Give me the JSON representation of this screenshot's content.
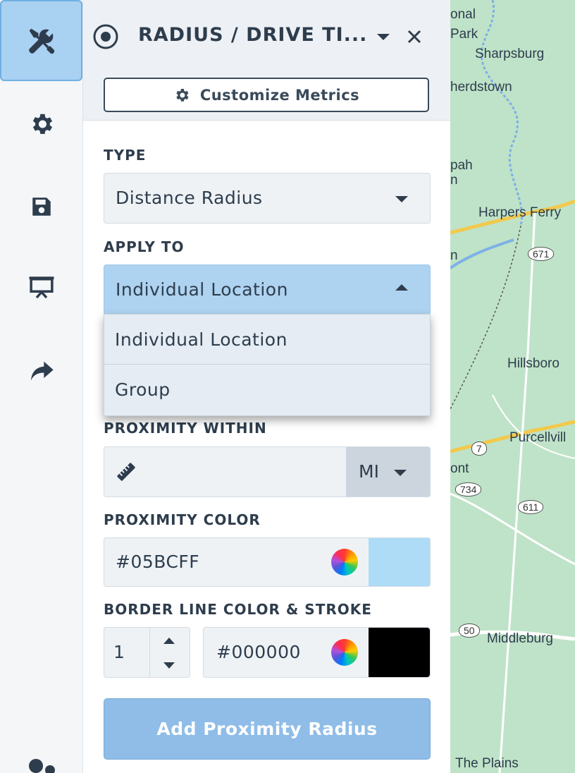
{
  "panel": {
    "title": "RADIUS / DRIVE TI...",
    "customize_label": "Customize Metrics"
  },
  "form": {
    "type_label": "TYPE",
    "type_value": "Distance Radius",
    "apply_label": "APPLY TO",
    "apply_value": "Individual Location",
    "apply_options": [
      "Individual Location",
      "Group"
    ],
    "proximity_label": "PROXIMITY WITHIN",
    "proximity_value": "",
    "unit_value": "MI",
    "color_label": "PROXIMITY COLOR",
    "color_value": "#05BCFF",
    "color_swatch": "#aedcf7",
    "border_label": "BORDER LINE COLOR & STROKE",
    "stroke_value": "1",
    "border_color_value": "#000000",
    "border_swatch": "#000000",
    "add_label": "Add Proximity Radius"
  },
  "rail": {
    "icons": [
      "tools-icon",
      "gear-icon",
      "save-icon",
      "presentation-icon",
      "share-icon",
      "user-settings-icon"
    ]
  },
  "map": {
    "labels": [
      "onal",
      "Park",
      "Sharpsburg",
      "herdstown",
      "pah",
      "n",
      "Harpers Ferry",
      "n",
      "Hillsboro",
      "Purcellvill",
      "ont",
      "Middleburg",
      "The Plains"
    ],
    "shields": [
      "671",
      "7",
      "734",
      "611",
      "50"
    ]
  },
  "colors": {
    "accent": "#a9d1f2",
    "primary_button": "#8fbde8",
    "text": "#2e3d4d",
    "map_green": "#b8e0c2"
  }
}
